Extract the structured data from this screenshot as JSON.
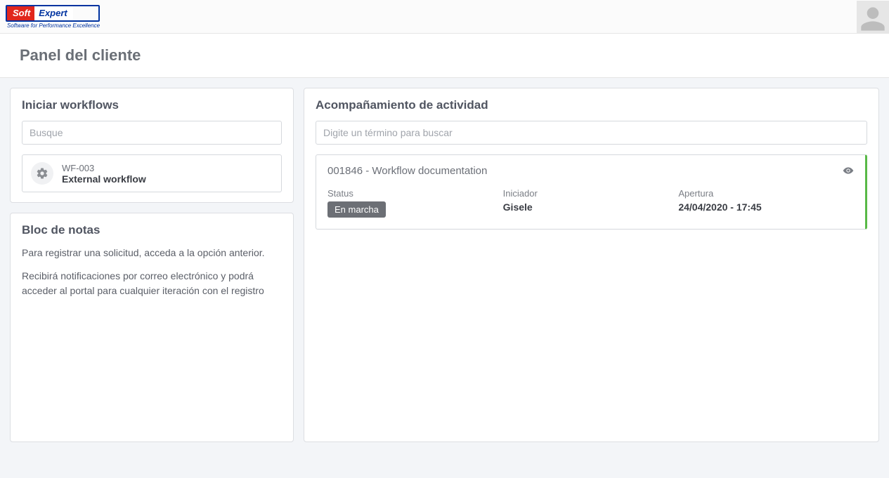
{
  "brand": {
    "logo_left": "Soft",
    "logo_right": "Expert",
    "tagline": "Software for Performance Excellence"
  },
  "page": {
    "title": "Panel del cliente"
  },
  "workflows_panel": {
    "heading": "Iniciar workflows",
    "search_placeholder": "Busque",
    "items": [
      {
        "code": "WF-003",
        "name": "External workflow"
      }
    ]
  },
  "notes_panel": {
    "heading": "Bloc de notas",
    "paragraphs": [
      "Para registrar una solicitud, acceda a la opción anterior.",
      "Recibirá notificaciones por correo electrónico y podrá acceder al portal para cualquier iteración con el registro"
    ]
  },
  "activity_panel": {
    "heading": "Acompañamiento de actividad",
    "search_placeholder": "Digite un término para buscar",
    "items": [
      {
        "title": "001846 - Workflow documentation",
        "fields": {
          "status_label": "Status",
          "status_badge": "En marcha",
          "initiator_label": "Iniciador",
          "initiator_value": "Gisele",
          "open_label": "Apertura",
          "open_value": "24/04/2020 - 17:45"
        }
      }
    ]
  }
}
